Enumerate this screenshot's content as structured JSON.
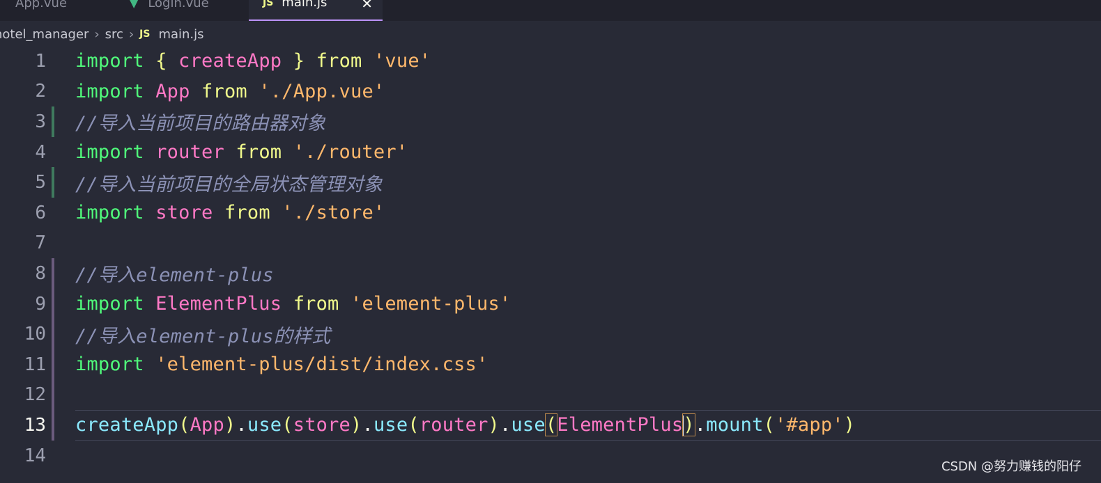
{
  "tabs": [
    {
      "label": "App.vue",
      "active": false
    },
    {
      "label": "Login.vue",
      "active": false,
      "icon": "vue-icon"
    },
    {
      "label": "main.js",
      "active": true,
      "icon": "js-icon",
      "close": "✕"
    }
  ],
  "breadcrumb": {
    "items": [
      "hotel_manager",
      "src",
      "main.js"
    ],
    "separator": "›",
    "js_badge": "JS"
  },
  "editor": {
    "active_line": 13,
    "lines": [
      {
        "n": "1",
        "text": "import { createApp } from 'vue'"
      },
      {
        "n": "2",
        "text": "import App from './App.vue'"
      },
      {
        "n": "3",
        "text": "//导入当前项目的路由器对象"
      },
      {
        "n": "4",
        "text": "import router from './router'"
      },
      {
        "n": "5",
        "text": "//导入当前项目的全局状态管理对象"
      },
      {
        "n": "6",
        "text": "import store from './store'"
      },
      {
        "n": "7",
        "text": ""
      },
      {
        "n": "8",
        "text": "//导入element-plus"
      },
      {
        "n": "9",
        "text": "import ElementPlus from 'element-plus'"
      },
      {
        "n": "10",
        "text": "//导入element-plus的样式"
      },
      {
        "n": "11",
        "text": "import 'element-plus/dist/index.css'"
      },
      {
        "n": "12",
        "text": ""
      },
      {
        "n": "13",
        "text": "createApp(App).use(store).use(router).use(ElementPlus).mount('#app')"
      },
      {
        "n": "14",
        "text": ""
      }
    ]
  },
  "tokens": {
    "import": "import",
    "from": "from",
    "lbrace": "{",
    "rbrace": "}",
    "createApp": "createApp",
    "App": "App",
    "router": "router",
    "store": "store",
    "ElementPlus": "ElementPlus",
    "str_vue": "'vue'",
    "str_app": "'./App.vue'",
    "str_router": "'./router'",
    "str_store": "'./store'",
    "str_ep": "'element-plus'",
    "str_css": "'element-plus/dist/index.css'",
    "cm3": "//导入当前项目的路由器对象",
    "cm5": "//导入当前项目的全局状态管理对象",
    "cm8": "//导入element-plus",
    "cm10": "//导入element-plus的样式",
    "use": "use",
    "mount": "mount",
    "dot": ".",
    "lparen": "(",
    "rparen": ")",
    "str_hash": "'#app'"
  },
  "watermark": "CSDN @努力赚钱的阳仔",
  "colors": {
    "background": "#282a36",
    "keyword": "#50fa7b",
    "identifier": "#ff79c6",
    "string": "#ffb86c",
    "comment": "#8b91b5",
    "function": "#8be9fd"
  }
}
